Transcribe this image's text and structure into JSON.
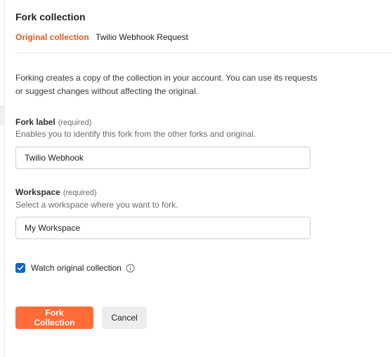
{
  "dialog": {
    "title": "Fork collection",
    "original_label": "Original collection",
    "original_value": "Twilio Webhook Request",
    "intro_text": "Forking creates a copy of the collection in your account. You can use its requests or suggest changes without affecting the original."
  },
  "fork_label": {
    "label": "Fork label",
    "required": "(required)",
    "help": "Enables you to identify this fork from the other forks and original.",
    "value": "Twilio Webhook"
  },
  "workspace": {
    "label": "Workspace",
    "required": "(required)",
    "help": "Select a workspace where you want to fork.",
    "value": "My Workspace"
  },
  "watch": {
    "label": "Watch original collection",
    "checked": true,
    "icon": "info-icon"
  },
  "actions": {
    "primary_label": "Fork Collection",
    "secondary_label": "Cancel"
  },
  "colors": {
    "accent": "#ff6c37",
    "accent_text": "#e3591f",
    "checkbox": "#0265d2"
  }
}
